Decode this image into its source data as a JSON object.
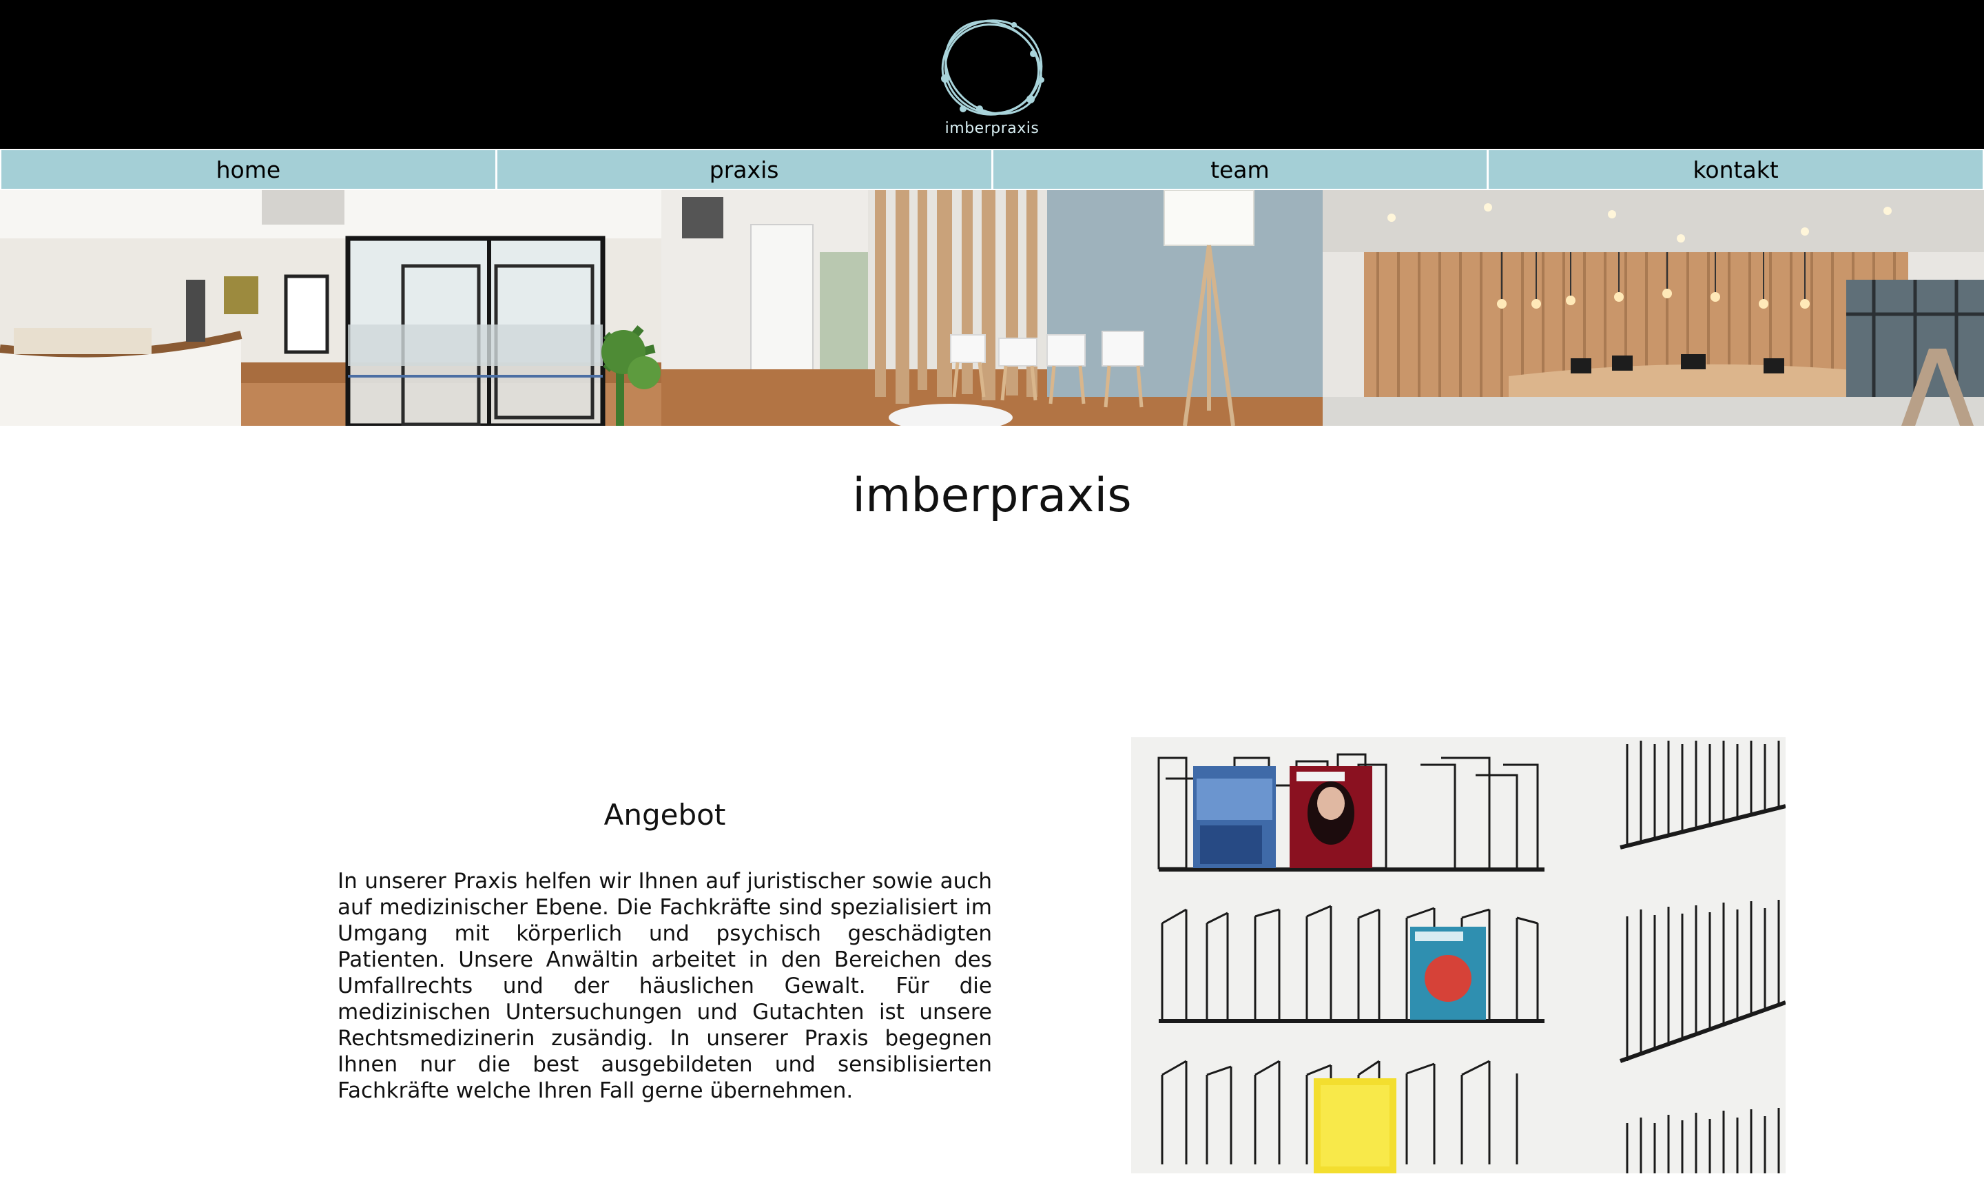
{
  "header": {
    "logo_text": "imberpraxis",
    "logo_icon": "orbit-rings-logo-icon"
  },
  "nav": {
    "items": [
      {
        "label": "home"
      },
      {
        "label": "praxis"
      },
      {
        "label": "team"
      },
      {
        "label": "kontakt"
      }
    ]
  },
  "banner": {
    "images": [
      "reception-glass-office-photo",
      "waiting-room-chairs-photo",
      "wooden-reception-desk-photo"
    ]
  },
  "main": {
    "title": "imberpraxis",
    "section": {
      "heading": "Angebot",
      "body": "In unserer Praxis helfen wir Ihnen auf juristischer sowie auch auf medizinischer Ebene. Die Fachkräfte sind spezialisiert im Umgang mit körperlich und psychisch geschädigten Patienten. Unsere Anwältin arbeitet in den Bereichen des Umfallrechts und der häuslichen Gewalt. Für die medizinischen Untersuchungen und Gutachten ist unsere Rechtsmedizinerin zusändig. In unserer Praxis begegnen Ihnen nur die best ausgebildeten und sensiblisierten Fachkräfte welche Ihren Fall gerne übernehmen.",
      "image": "magazine-rack-photo"
    }
  },
  "colors": {
    "header_bg": "#000000",
    "nav_bg": "#a4cfd6",
    "logo_color": "#a9d4db"
  }
}
